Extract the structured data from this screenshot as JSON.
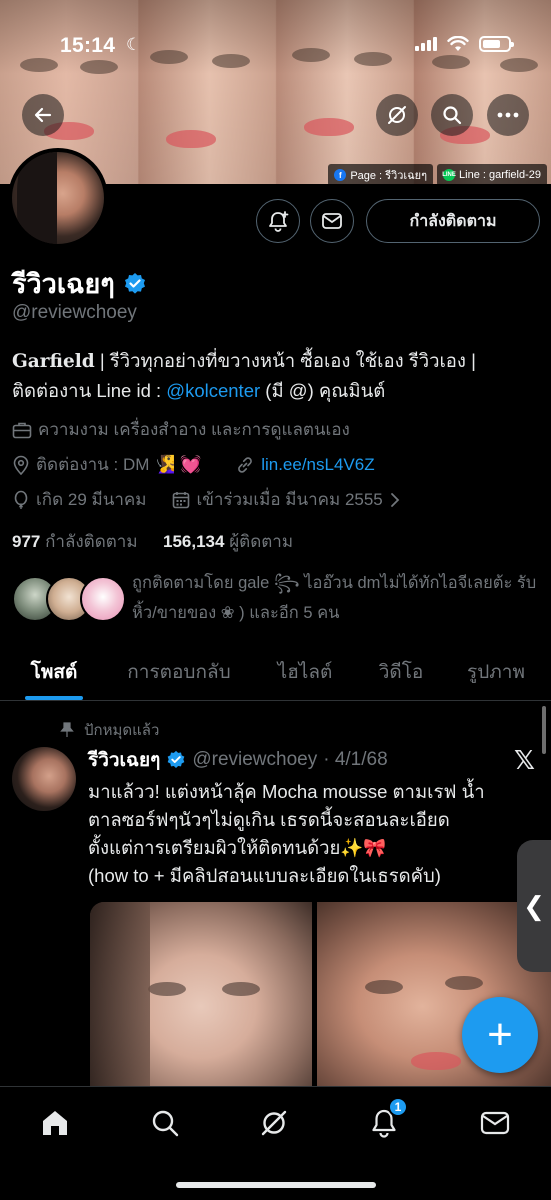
{
  "status_bar": {
    "time": "15:14"
  },
  "banner": {
    "page_tag": "Page : รีวิวเฉยๆ",
    "line_tag": "Line : garfield-29"
  },
  "profile": {
    "follow_button": "กำลังติดตาม",
    "display_name": "รีวิวเฉยๆ",
    "handle": "@reviewchoey",
    "bio_name": "Garfield",
    "bio_line1": " | รีวิวทุกอย่างที่ขวางหน้า ซื้อเอง ใช้เอง รีวิวเอง |",
    "bio_line2_pre": "ติดต่องาน Line id : ",
    "bio_line2_link": "@kolcenter",
    "bio_line2_post": " (มี @) คุณมินต์",
    "category": "ความงาม เครื่องสำอาง และการดูแลตนเอง",
    "location": "ติดต่องาน : DM 🧏‍♀️ 💓",
    "website": "lin.ee/nsL4V6Z",
    "birthday": "เกิด 29 มีนาคม",
    "joined": "เข้าร่วมเมื่อ มีนาคม 2555",
    "following_count": "977",
    "following_label": "กำลังติดตาม",
    "followers_count": "156,134",
    "followers_label": "ผู้ติดตาม",
    "followed_by": "ถูกติดตามโดย gale ꧂ ไออ๊วน dmไม่ได้ทักไอจีเลยต้ะ รับหิ้ว/ขายของ ❀ ) และอีก 5 คน"
  },
  "tabs": [
    "โพสต์",
    "การตอบกลับ",
    "ไฮไลต์",
    "วิดีโอ",
    "รูปภาพ"
  ],
  "post": {
    "pinned_label": "ปักหมุดแล้ว",
    "author_name": "รีวิวเฉยๆ",
    "author_handle": "@reviewchoey",
    "date": "· 4/1/68",
    "line1": "มาแล้วว! แต่งหน้าลุ้ค Mocha mousse ตามเรฟ น้ำ",
    "line2": "ตาลซอร์ฟๆนัวๆไม่ดูเกิน เธรดนี้จะสอนละเอียด",
    "line3": "ตั้งแต่การเตรียมผิวให้ติดทนด้วย✨🎀",
    "line4": "(how to + มีคลิปสอนแบบละเอียดในเธรดคับ)"
  },
  "notification_badge": "1",
  "colors": {
    "accent": "#1d9bf0",
    "background": "#000000",
    "muted": "#71767b"
  }
}
